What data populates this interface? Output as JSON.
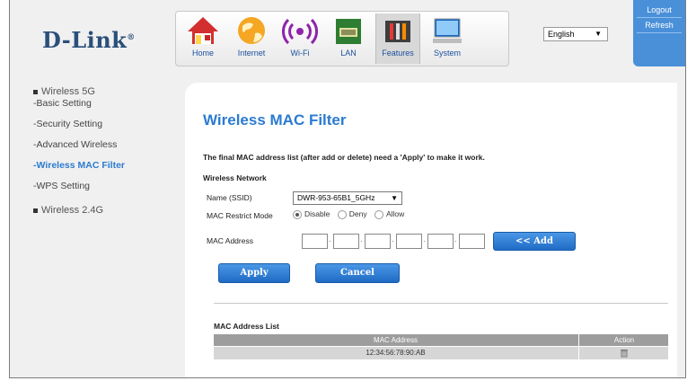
{
  "header": {
    "logo": "D-Link",
    "nav": [
      {
        "label": "Home",
        "icon": "home-icon"
      },
      {
        "label": "Internet",
        "icon": "globe-icon"
      },
      {
        "label": "Wi-Fi",
        "icon": "wifi-icon"
      },
      {
        "label": "LAN",
        "icon": "lan-icon"
      },
      {
        "label": "Features",
        "icon": "tools-icon"
      },
      {
        "label": "System",
        "icon": "computer-icon"
      }
    ],
    "language": "English",
    "logout": "Logout",
    "refresh": "Refresh"
  },
  "sidebar": {
    "group1": "Wireless 5G",
    "items": [
      "-Basic Setting",
      "-Security Setting",
      "-Advanced Wireless",
      "-Wireless MAC Filter",
      "-WPS Setting"
    ],
    "group2": "Wireless 2.4G"
  },
  "main": {
    "title": "Wireless MAC Filter",
    "note": "The final MAC address list (after add or delete) need a 'Apply' to make it work.",
    "section": "Wireless Network",
    "ssid_label": "Name  (SSID)",
    "ssid_value": "DWR-953-65B1_5GHz",
    "mode_label": "MAC Restrict Mode",
    "modes": [
      "Disable",
      "Deny",
      "Allow"
    ],
    "mode_selected": "Disable",
    "mac_label": "MAC Address",
    "add_button": "<< Add",
    "apply_button": "Apply",
    "cancel_button": "Cancel",
    "list_title": "MAC Address List",
    "table": {
      "headers": [
        "MAC Address",
        "Action"
      ],
      "rows": [
        [
          "12:34:56:78:90:AB",
          "trash-icon"
        ]
      ]
    }
  },
  "colors": {
    "accent": "#2b7bd0",
    "button": "#1f6bc5",
    "auth_box": "#4a90d9"
  }
}
